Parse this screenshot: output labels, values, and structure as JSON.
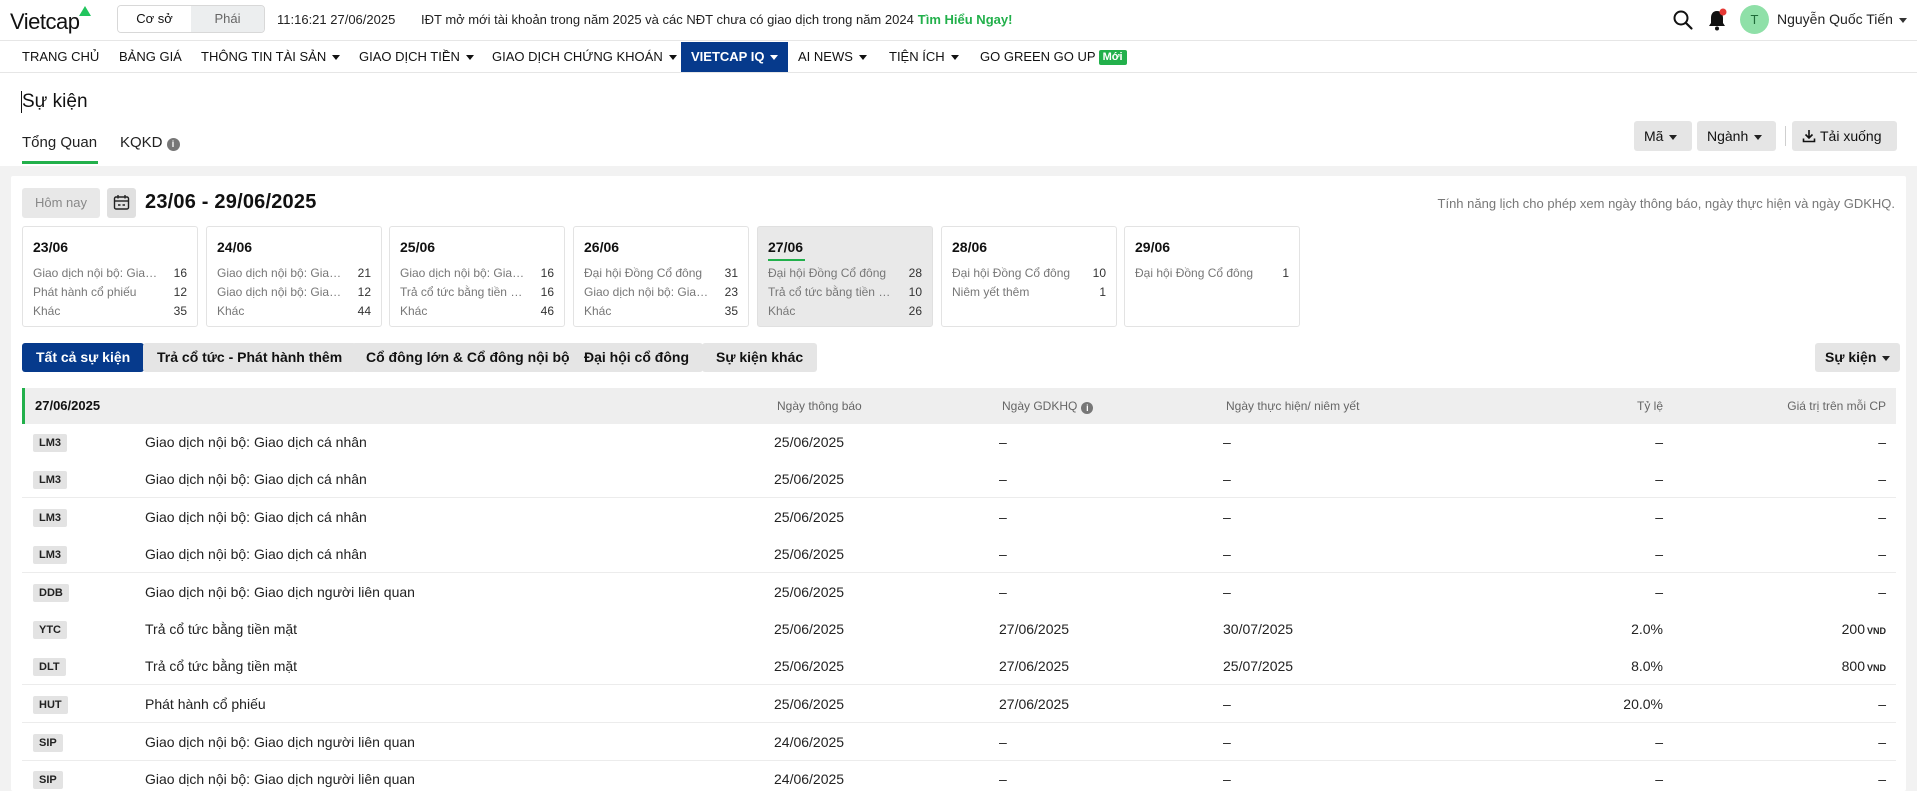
{
  "header": {
    "logo": "Vietcap",
    "segments": [
      "Cơ sở",
      "Phái sinh"
    ],
    "clock": "11:16:21 27/06/2025",
    "promo_text": "IĐT mở mới tài khoản trong năm 2025 và các NĐT chưa có giao dịch trong năm 2024",
    "promo_link": "Tìm Hiểu Ngay!",
    "avatar_initial": "T",
    "user_name": "Nguyễn Quốc Tiến",
    "icons": [
      "search-icon",
      "bell-icon"
    ],
    "accent": "#22b04b",
    "brand": "#063a8c"
  },
  "nav": {
    "items": [
      {
        "label": "TRANG CHỦ"
      },
      {
        "label": "BẢNG GIÁ"
      },
      {
        "label": "THÔNG TIN TÀI SẢN"
      },
      {
        "label": "GIAO DỊCH TIỀN"
      },
      {
        "label": "GIAO DỊCH CHỨNG KHOÁN"
      },
      {
        "label": "VIETCAP IQ"
      },
      {
        "label": "AI NEWS"
      },
      {
        "label": "TIỆN ÍCH"
      },
      {
        "label": "GO GREEN GO UP"
      }
    ],
    "new_badge": "Mới"
  },
  "page": {
    "title": "Sự kiện",
    "tabs": [
      "Tổng Quan",
      "KQKD"
    ],
    "buttons": {
      "ticker": "Mã",
      "industry": "Ngành",
      "download": "Tải xuống"
    }
  },
  "calendar": {
    "today_label": "Hôm nay",
    "range": "23/06 - 29/06/2025",
    "hint": "Tính năng lịch cho phép xem ngày thông báo, ngày thực hiện và ngày GDKHQ.",
    "days": [
      {
        "date": "23/06",
        "rows": [
          {
            "label": "Giao dịch nội bộ: Giao dị...",
            "count": "16"
          },
          {
            "label": "Phát hành cổ phiếu",
            "count": "12"
          },
          {
            "label": "Khác",
            "count": "35"
          }
        ]
      },
      {
        "date": "24/06",
        "rows": [
          {
            "label": "Giao dịch nội bộ: Giao dị...",
            "count": "21"
          },
          {
            "label": "Giao dịch nội bộ: Giao dị...",
            "count": "12"
          },
          {
            "label": "Khác",
            "count": "44"
          }
        ]
      },
      {
        "date": "25/06",
        "rows": [
          {
            "label": "Giao dịch nội bộ: Giao dị...",
            "count": "16"
          },
          {
            "label": "Trả cổ tức bằng tiền mặt",
            "count": "16"
          },
          {
            "label": "Khác",
            "count": "46"
          }
        ]
      },
      {
        "date": "26/06",
        "rows": [
          {
            "label": "Đại hội Đồng Cổ đông",
            "count": "31"
          },
          {
            "label": "Giao dịch nội bộ: Giao dị...",
            "count": "23"
          },
          {
            "label": "Khác",
            "count": "35"
          }
        ]
      },
      {
        "date": "27/06",
        "rows": [
          {
            "label": "Đại hội Đồng Cổ đông",
            "count": "28"
          },
          {
            "label": "Trả cổ tức bằng tiền mặt",
            "count": "10"
          },
          {
            "label": "Khác",
            "count": "26"
          }
        ]
      },
      {
        "date": "28/06",
        "rows": [
          {
            "label": "Đại hội Đồng Cổ đông",
            "count": "10"
          },
          {
            "label": "Niêm yết thêm",
            "count": "1"
          }
        ]
      },
      {
        "date": "29/06",
        "rows": [
          {
            "label": "Đại hội Đồng Cổ đông",
            "count": "1"
          }
        ]
      }
    ]
  },
  "filters": {
    "all": "Tất cả sự kiện",
    "dividend": "Trả cổ tức - Phát hành thêm",
    "shareholders": "Cổ đông lớn & Cổ đông nội bộ",
    "agm": "Đại hội cổ đông",
    "other": "Sự kiện khác",
    "event_dropdown": "Sự kiện"
  },
  "table": {
    "group_date": "27/06/2025",
    "headers": {
      "announce": "Ngày thông báo",
      "exdate": "Ngày GDKHQ",
      "execute": "Ngày thực hiện/ niêm yết",
      "ratio": "Tỷ lệ",
      "value": "Giá trị trên mỗi CP"
    },
    "currency": "VND",
    "rows": [
      {
        "ticker": "LM3",
        "event": "Giao dịch nội bộ: Giao dịch cá nhân",
        "announce": "25/06/2025",
        "exdate": "–",
        "execute": "–",
        "ratio": "–",
        "value": "–"
      },
      {
        "ticker": "LM3",
        "event": "Giao dịch nội bộ: Giao dịch cá nhân",
        "announce": "25/06/2025",
        "exdate": "–",
        "execute": "–",
        "ratio": "–",
        "value": "–"
      },
      {
        "ticker": "LM3",
        "event": "Giao dịch nội bộ: Giao dịch cá nhân",
        "announce": "25/06/2025",
        "exdate": "–",
        "execute": "–",
        "ratio": "–",
        "value": "–"
      },
      {
        "ticker": "LM3",
        "event": "Giao dịch nội bộ: Giao dịch cá nhân",
        "announce": "25/06/2025",
        "exdate": "–",
        "execute": "–",
        "ratio": "–",
        "value": "–"
      },
      {
        "ticker": "DDB",
        "event": "Giao dịch nội bộ: Giao dịch người liên quan",
        "announce": "25/06/2025",
        "exdate": "–",
        "execute": "–",
        "ratio": "–",
        "value": "–"
      },
      {
        "ticker": "YTC",
        "event": "Trả cổ tức bằng tiền mặt",
        "announce": "25/06/2025",
        "exdate": "27/06/2025",
        "execute": "30/07/2025",
        "ratio": "2.0%",
        "value": "200"
      },
      {
        "ticker": "DLT",
        "event": "Trả cổ tức bằng tiền mặt",
        "announce": "25/06/2025",
        "exdate": "27/06/2025",
        "execute": "25/07/2025",
        "ratio": "8.0%",
        "value": "800"
      },
      {
        "ticker": "HUT",
        "event": "Phát hành cổ phiếu",
        "announce": "25/06/2025",
        "exdate": "27/06/2025",
        "execute": "–",
        "ratio": "20.0%",
        "value": "–"
      },
      {
        "ticker": "SIP",
        "event": "Giao dịch nội bộ: Giao dịch người liên quan",
        "announce": "24/06/2025",
        "exdate": "–",
        "execute": "–",
        "ratio": "–",
        "value": "–"
      },
      {
        "ticker": "SIP",
        "event": "Giao dịch nội bộ: Giao dịch người liên quan",
        "announce": "24/06/2025",
        "exdate": "–",
        "execute": "–",
        "ratio": "–",
        "value": "–"
      }
    ]
  }
}
